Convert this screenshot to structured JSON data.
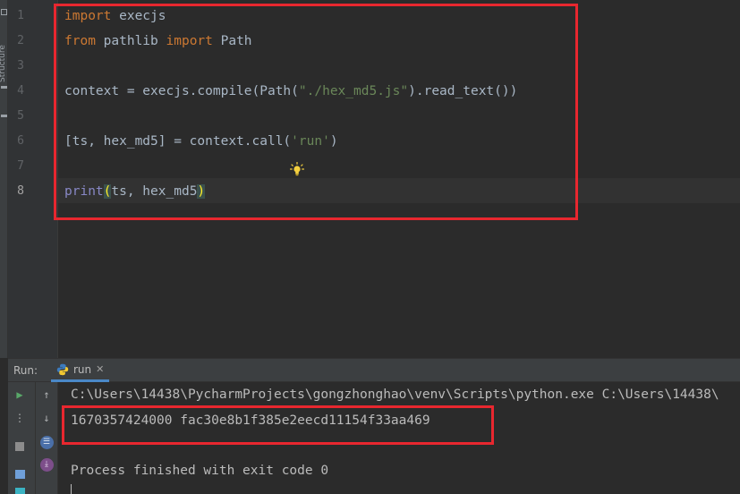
{
  "side_panel": {
    "label": "Structure"
  },
  "editor": {
    "line_numbers": [
      "1",
      "2",
      "3",
      "4",
      "5",
      "6",
      "7",
      "8"
    ],
    "current_line": "8",
    "lines": [
      {
        "kw1": "import",
        "rest": " execjs"
      },
      {
        "kw1": "from",
        "mid": " pathlib ",
        "kw2": "import",
        "rest": " Path"
      },
      {},
      {
        "pre": "context = execjs.compile(Path(",
        "str": "\"./hex_md5.js\"",
        "post": ").read_text())"
      },
      {},
      {
        "pre": "[ts, hex_md5] = context.call(",
        "str": "'run'",
        "post": ")"
      },
      {},
      {
        "builtin": "print",
        "open": "(",
        "args": "ts, hex_md5",
        "close": ")"
      }
    ]
  },
  "run_window": {
    "label": "Run:",
    "tab": "run",
    "console": {
      "command": "C:\\Users\\14438\\PycharmProjects\\gongzhonghao\\venv\\Scripts\\python.exe C:\\Users\\14438\\",
      "output": "1670357424000 fac30e8b1f385e2eecd11154f33aa469",
      "finish": "Process finished with exit code 0"
    }
  },
  "colors": {
    "highlight_box": "#e8272f",
    "keyword": "#cc7832",
    "string": "#6a8759",
    "builtin": "#8888c6"
  }
}
